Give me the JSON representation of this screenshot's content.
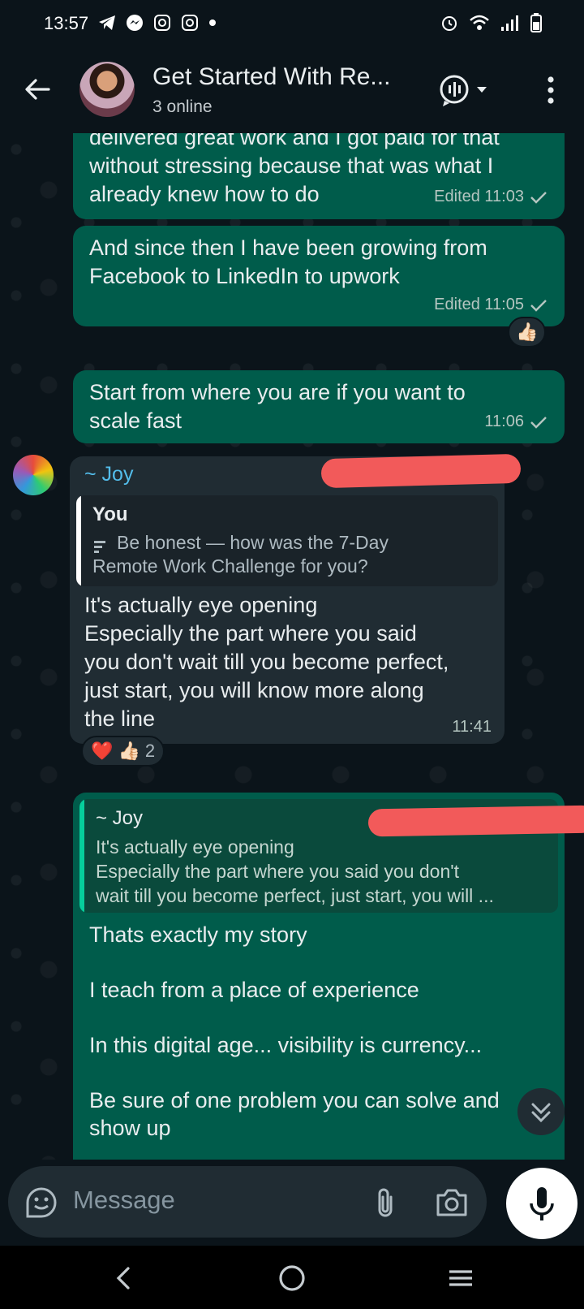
{
  "status_bar": {
    "time": "13:57",
    "icons_left": [
      "telegram-icon",
      "messenger-icon",
      "instagram-icon",
      "instagram-icon",
      "dot-icon"
    ],
    "icons_right": [
      "alarm-icon",
      "wifi-icon",
      "signal-icon",
      "battery-icon"
    ]
  },
  "header": {
    "title": "Get Started With Re...",
    "subtitle": "3 online",
    "icons": [
      "back-arrow-icon",
      "group-avatar",
      "voice-chat-icon",
      "more-vert-icon"
    ]
  },
  "messages": [
    {
      "direction": "out",
      "text": "delivered great work and I got paid for that\nwithout stressing because that was what I\nalready knew how to do",
      "meta": "Edited 11:03",
      "status": "sent"
    },
    {
      "direction": "out",
      "text": "And since then I have been growing from\nFacebook to LinkedIn to upwork",
      "meta": "Edited 11:05",
      "status": "sent",
      "reaction": "👍🏻"
    },
    {
      "direction": "out",
      "text": "Start from where you are if you want to\nscale fast",
      "meta": "11:06",
      "status": "sent"
    },
    {
      "direction": "in",
      "sender": "~ Joy",
      "quote": {
        "author": "You",
        "text": "Be honest — how was the 7-Day\nRemote Work Challenge for you?"
      },
      "text": "It's actually eye opening\nEspecially the part where you said\nyou don't wait till you become perfect,\njust start, you will know more along\nthe line",
      "meta": "11:41",
      "reactions": {
        "emojis": "❤️ 👍🏻",
        "count": "2"
      }
    },
    {
      "direction": "out",
      "quote": {
        "author": "~ Joy",
        "text": "It's actually eye opening\nEspecially the part where you said you don't\nwait till you become perfect, just start, you will ..."
      },
      "text": "Thats exactly my story\n\nI teach from a place of experience\n\nIn this digital age... visibility is currency...\n\nBe sure of one problem you can solve and\nshow up"
    }
  ],
  "composer": {
    "placeholder": "Message",
    "icons": [
      "sticker-icon",
      "attach-icon",
      "camera-icon",
      "mic-icon"
    ]
  },
  "nav": {
    "icons": [
      "nav-back-icon",
      "nav-home-icon",
      "nav-recents-icon"
    ]
  },
  "colors": {
    "background": "#0b141a",
    "bubble_out": "#005c4b",
    "bubble_in": "#202c33",
    "sender_name": "#53bdeb",
    "quote_bar_in": "#ffffff",
    "quote_bar_out": "#06cf9c",
    "redaction": "#f25a5a"
  }
}
